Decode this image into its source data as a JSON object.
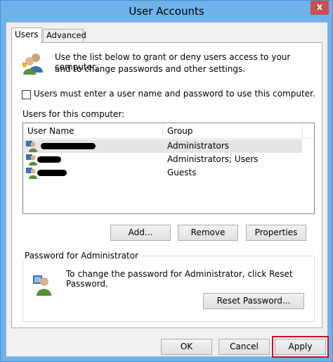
{
  "window": {
    "title": "User Accounts",
    "close_glyph": "x"
  },
  "tabs": [
    {
      "label": "Users",
      "active": true
    },
    {
      "label": "Advanced",
      "active": false
    }
  ],
  "intro": {
    "line1": "Use the list below to grant or deny users access to your computer,",
    "line2": "and to change passwords and other settings."
  },
  "require_login": {
    "label": "Users must enter a user name and password to use this computer.",
    "checked": false
  },
  "users_list": {
    "label": "Users for this computer:",
    "columns": [
      "User Name",
      "Group"
    ],
    "rows": [
      {
        "group": "Administrators",
        "selected": true
      },
      {
        "group": "Administrators; Users",
        "selected": false
      },
      {
        "group": "Guests",
        "selected": false
      }
    ]
  },
  "list_buttons": {
    "add": "Add...",
    "remove": "Remove",
    "properties": "Properties"
  },
  "password_group": {
    "title": "Password for Administrator",
    "text": "To change the password for Administrator, click Reset Password.",
    "reset_button": "Reset Password..."
  },
  "dialog_buttons": {
    "ok": "OK",
    "cancel": "Cancel",
    "apply": "Apply"
  },
  "colors": {
    "frame": "#6fb1e9",
    "highlight": "#c8102e"
  }
}
